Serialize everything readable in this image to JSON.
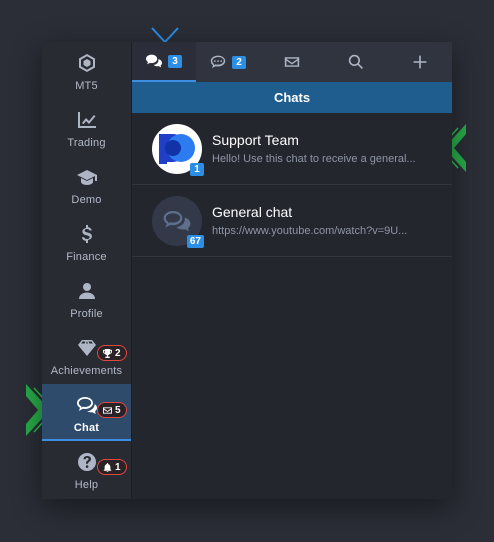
{
  "sidebar": {
    "items": [
      {
        "label": "MT5",
        "icon": "mt5-icon"
      },
      {
        "label": "Trading",
        "icon": "chart-line-icon"
      },
      {
        "label": "Demo",
        "icon": "graduation-cap-icon"
      },
      {
        "label": "Finance",
        "icon": "dollar-icon"
      },
      {
        "label": "Profile",
        "icon": "user-icon"
      },
      {
        "label": "Achievements",
        "icon": "diamond-icon",
        "badge": "2",
        "badge_icon": "trophy-icon"
      },
      {
        "label": "Chat",
        "icon": "chat-icon",
        "badge": "5",
        "badge_icon": "envelope-icon",
        "active": true
      },
      {
        "label": "Help",
        "icon": "question-icon",
        "badge": "1",
        "badge_icon": "bell-icon"
      }
    ]
  },
  "tabs": [
    {
      "icon": "chats-icon",
      "count": "3",
      "active": true
    },
    {
      "icon": "comment-dots-icon",
      "count": "2"
    },
    {
      "icon": "envelope-icon"
    },
    {
      "icon": "search-icon"
    },
    {
      "icon": "plus-icon"
    }
  ],
  "header": {
    "title": "Chats"
  },
  "chats": [
    {
      "name": "Support Team",
      "preview": "Hello! Use this chat to receive a general...",
      "badge": "1"
    },
    {
      "name": "General chat",
      "preview": "https://www.youtube.com/watch?v=9U...",
      "badge": "67"
    }
  ],
  "colors": {
    "accent": "#2d8ee6",
    "header": "#1f5d8e",
    "badge_border": "#e0483f",
    "pointer_green": "#27c24c",
    "pointer_blue": "#2d8ee6"
  }
}
